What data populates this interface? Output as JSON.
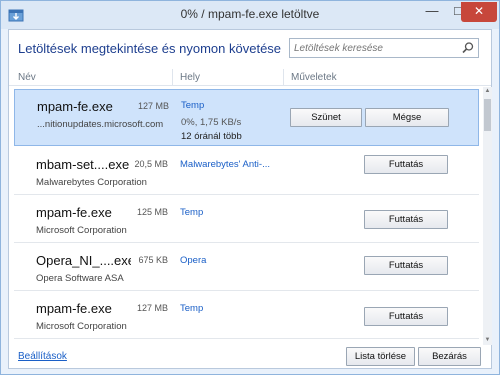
{
  "window": {
    "title": "0% / mpam-fe.exe letöltve",
    "heading": "Letöltések megtekintése és nyomon követése",
    "close_symbol": "✕",
    "minimize_symbol": "—",
    "maximize_symbol": "□"
  },
  "search": {
    "placeholder": "Letöltések keresése",
    "icon": "search-icon"
  },
  "columns": {
    "name": "Név",
    "location": "Hely",
    "actions": "Műveletek"
  },
  "downloads": [
    {
      "name": "mpam-fe.exe",
      "size": "127 MB",
      "source": "...nitionupdates.microsoft.com",
      "location": "Temp",
      "status": "0%, 1,75 KB/s",
      "remaining": "12 óránál több",
      "buttons": [
        "Szünet",
        "Mégse"
      ],
      "selected": true
    },
    {
      "name": "mbam-set....exe",
      "size": "20,5 MB",
      "source": "Malwarebytes Corporation",
      "location": "Malwarebytes' Anti-...",
      "buttons": [
        "Futtatás"
      ]
    },
    {
      "name": "mpam-fe.exe",
      "size": "125 MB",
      "source": "Microsoft Corporation",
      "location": "Temp",
      "buttons": [
        "Futtatás"
      ]
    },
    {
      "name": "Opera_NI_....exe",
      "size": "675 KB",
      "source": "Opera Software ASA",
      "location": "Opera",
      "buttons": [
        "Futtatás"
      ]
    },
    {
      "name": "mpam-fe.exe",
      "size": "127 MB",
      "source": "Microsoft Corporation",
      "location": "Temp",
      "buttons": [
        "Futtatás"
      ]
    }
  ],
  "footer": {
    "settings_link": "Beállítások",
    "clear_list": "Lista törlése",
    "close": "Bezárás"
  },
  "colors": {
    "accent": "#1a5fc7",
    "selected_row": "#cfe3fb",
    "close_button": "#c7473b"
  }
}
